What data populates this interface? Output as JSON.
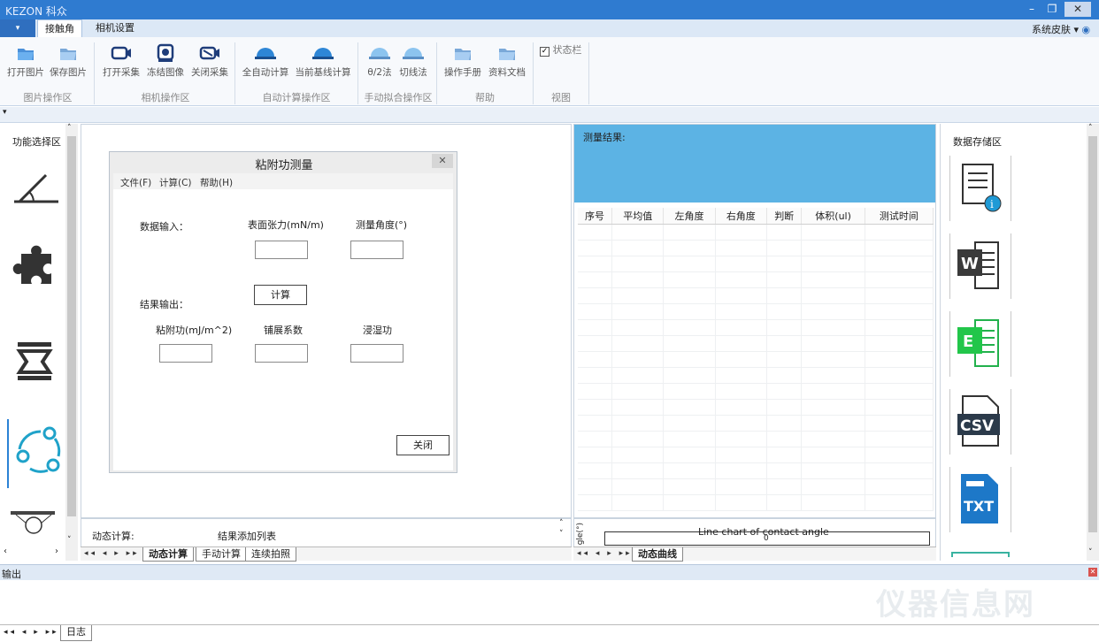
{
  "window": {
    "title": "KEZON 科众"
  },
  "menubar": {
    "tab_active": "接触角",
    "tab_other": "相机设置",
    "skin": "系统皮肤"
  },
  "ribbon": {
    "buttons": [
      "打开图片",
      "保存图片",
      "打开采集",
      "冻结图像",
      "关闭采集",
      "全自动计算",
      "当前基线计算",
      "θ/2法",
      "切线法",
      "操作手册",
      "资料文档"
    ],
    "statusbar_label": "状态栏",
    "groups": [
      "图片操作区",
      "相机操作区",
      "自动计算操作区",
      "手动拟合操作区",
      "帮助",
      "视图"
    ]
  },
  "left": {
    "title": "功能选择区"
  },
  "dialog": {
    "title": "粘附功测量",
    "menu": [
      "文件(F)",
      "计算(C)",
      "帮助(H)"
    ],
    "data_input": "数据输入：",
    "surface_tension": "表面张力(mN/m)",
    "measure_angle": "测量角度(°)",
    "result_output": "结果输出：",
    "calc_button": "计算",
    "adhesion": "粘附功(mJ/m^2)",
    "spreading": "铺展系数",
    "immersion": "浸湿功",
    "close_button": "关闭",
    "surface_tension_value": "",
    "measure_angle_value": "",
    "adhesion_value": "",
    "spreading_value": "",
    "immersion_value": ""
  },
  "centerbottom": {
    "label1": "动态计算:",
    "label2": "结果添加列表",
    "tabs": [
      "动态计算",
      "手动计算",
      "连续拍照"
    ]
  },
  "results": {
    "header": "测量结果:",
    "columns": [
      "序号",
      "平均值",
      "左角度",
      "右角度",
      "判断",
      "体积(ul)",
      "测试时间"
    ]
  },
  "chart": {
    "title": "Line chart of contact angle",
    "ylabel": "gle(°)",
    "zero": "0",
    "tab": "动态曲线"
  },
  "right": {
    "title": "数据存储区",
    "icons": [
      "W",
      "E",
      "CSV",
      "TXT"
    ]
  },
  "output": {
    "label": "输出"
  },
  "log": {
    "tab": "日志"
  },
  "watermark": "仪器信息网"
}
